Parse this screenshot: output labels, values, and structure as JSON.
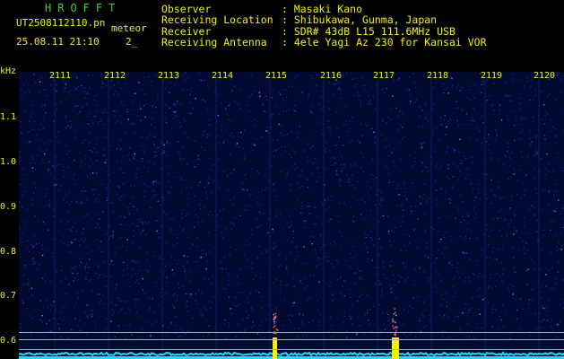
{
  "header": {
    "brand": "HROFFT",
    "filename_a": "UT2508112110.pn",
    "filename_b": "meteor",
    "date_time": "25.08.11 21:10",
    "date_suffix": "2_"
  },
  "info": [
    {
      "key": "Observer",
      "sep": ": ",
      "value": "Masaki Kano"
    },
    {
      "key": "Receiving Location",
      "sep": ": ",
      "value": "Shibukawa, Gunma, Japan"
    },
    {
      "key": "Receiver",
      "sep": ": ",
      "value": "SDR# 43dB L15 111.6MHz USB"
    },
    {
      "key": "Receiving Antenna",
      "sep": ": ",
      "value": "4ele Yagi Az 230 for Kansai VOR"
    }
  ],
  "axes": {
    "y_unit": "kHz",
    "y_ticks": [
      "1.1",
      "1.0",
      "0.9",
      "0.8",
      "0.7",
      "0.6"
    ],
    "x_ticks": [
      "2111",
      "2112",
      "2113",
      "2114",
      "2115",
      "2116",
      "2117",
      "2118",
      "2119",
      "2120"
    ]
  },
  "colors": {
    "background": "#020a32",
    "text": "#f2f200",
    "brand": "#3fd03f",
    "trace": "#00e8ff",
    "event": "#ffee00"
  },
  "events": [
    {
      "time": "2115",
      "label": "meteor-echo"
    },
    {
      "time": "2117",
      "label": "meteor-echo"
    }
  ]
}
